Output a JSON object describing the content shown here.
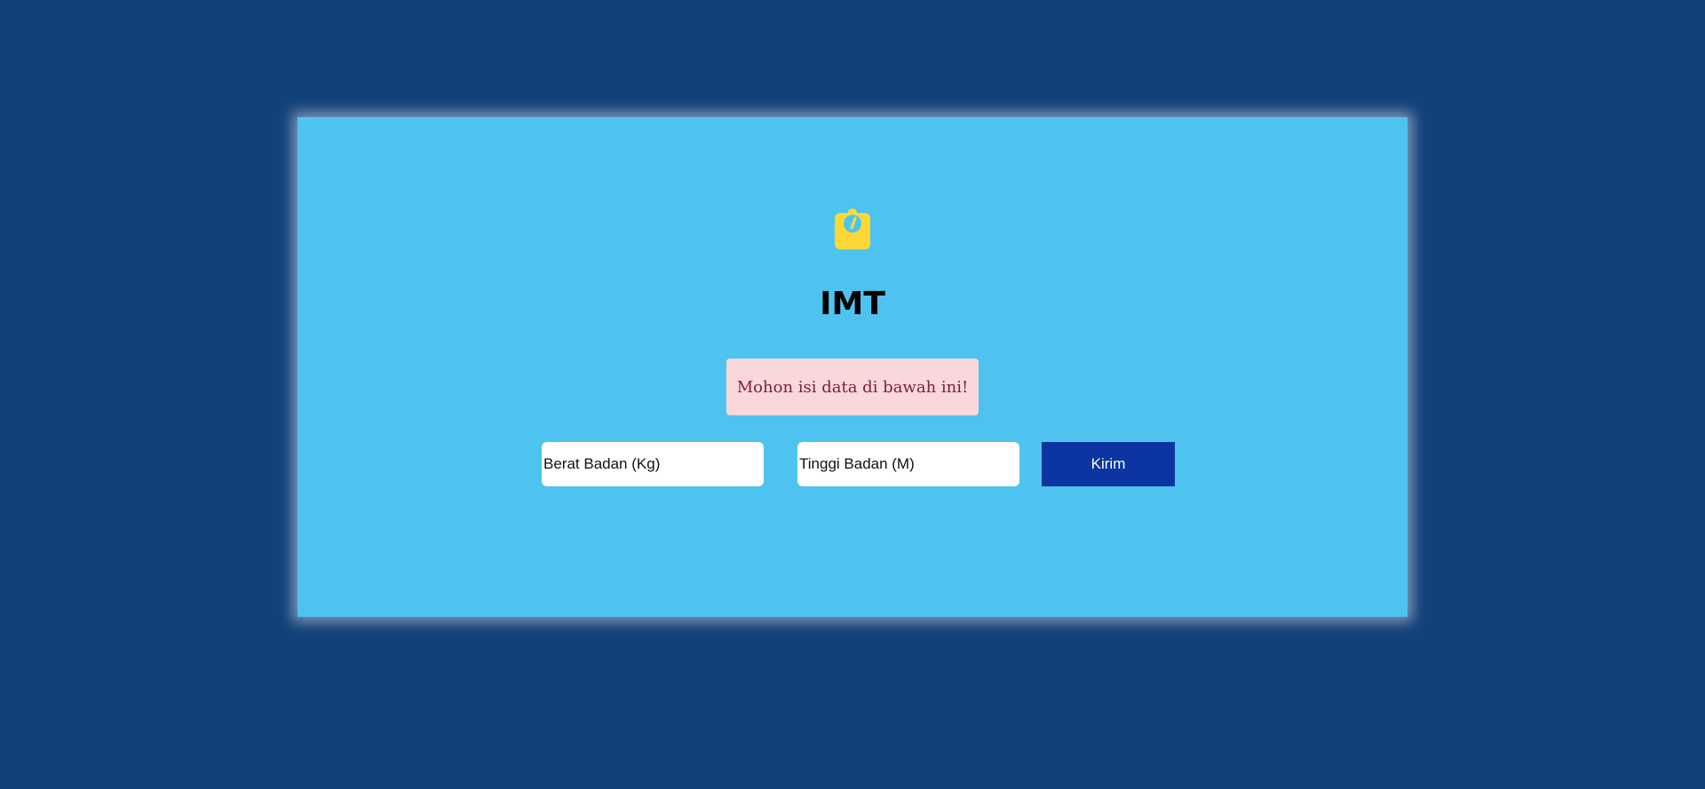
{
  "app": {
    "title": "IMT",
    "logo_icon": "weight-scale-icon"
  },
  "alert": {
    "message": "Mohon isi data di bawah ini!"
  },
  "form": {
    "weight_placeholder": "Berat Badan (Kg)",
    "height_placeholder": "Tinggi Badan (M)",
    "submit_label": "Kirim"
  },
  "colors": {
    "page_background": "#124079",
    "card_background": "#4fc3ef",
    "logo": "#fdd835",
    "alert_background": "#f9d7da",
    "alert_text": "#7a2430",
    "button_background": "#0c35a1"
  }
}
